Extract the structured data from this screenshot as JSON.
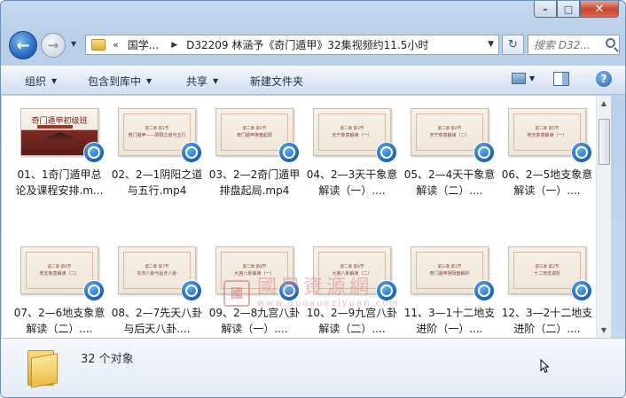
{
  "window": {
    "caption": {
      "minimize": "–",
      "maximize": "□",
      "close": "✕"
    }
  },
  "nav": {
    "back": "←",
    "forward": "→",
    "history_arrow": "▼",
    "address": {
      "chevron": "«",
      "crumbs": [
        "国学...",
        "D32209 林涵予《奇门遁甲》32集视频约11.5小时"
      ],
      "separator": "▶",
      "dropdown": "▼"
    },
    "refresh": "↻",
    "search_placeholder": "搜索 D32..."
  },
  "toolbar": {
    "organize": "组织",
    "include_library": "包含到库中",
    "share": "共享",
    "new_folder": "新建文件夹",
    "dropdown_arrow": "▼"
  },
  "files": [
    {
      "name": "01、1奇门遁甲总论及课程安排.m...",
      "thumb_title": "奇门遁甲初级班",
      "thumb_sub": "",
      "cover": true
    },
    {
      "name": "02、2—1阴阳之道与五行.mp4",
      "thumb_title": "第二章 第1节",
      "thumb_sub": "奇门遁甲——阴阳之道与五行"
    },
    {
      "name": "03、2—2奇门遁甲排盘起局.mp4",
      "thumb_title": "第二章 第2节",
      "thumb_sub": "奇门遁甲排盘起局"
    },
    {
      "name": "04、2—3天干象意解读（一）....",
      "thumb_title": "第二章 第3节",
      "thumb_sub": "天干象意解读（一）"
    },
    {
      "name": "05、2—4天干象意解读（二）....",
      "thumb_title": "第二章 第4节",
      "thumb_sub": "天干象意解读（二）"
    },
    {
      "name": "06、2—5地支象意解读（一）....",
      "thumb_title": "第二章 第5节",
      "thumb_sub": "地支象意解读（一）"
    },
    {
      "name": "07、2—6地支象意解读（二）....",
      "thumb_title": "第二章 第6节",
      "thumb_sub": "地支象意解读（二）"
    },
    {
      "name": "08、2—7先天八卦与后天八卦....",
      "thumb_title": "第二章 第7节",
      "thumb_sub": "先天八卦与后天八卦"
    },
    {
      "name": "09、2—8九宫八卦解读（一）....",
      "thumb_title": "第二章 第8节",
      "thumb_sub": "九宫八卦解读（一）"
    },
    {
      "name": "10、2—9九宫八卦解读（二）....",
      "thumb_title": "第二章 第9节",
      "thumb_sub": "九宫八卦解读（二）"
    },
    {
      "name": "11、3—1十二地支进阶（一）....",
      "thumb_title": "第三章 第1节",
      "thumb_sub": "奇门遁甲阴阳盘解析"
    },
    {
      "name": "12、3—2十二地支进阶（二）....",
      "thumb_title": "第三章 第2节",
      "thumb_sub": "十二地支进阶"
    }
  ],
  "watermark": {
    "seal": "國",
    "cn": "國學資源網",
    "url": "www.guoxueziyuan.com"
  },
  "status": {
    "count": "32 个对象"
  },
  "scrollbar": {
    "up": "▲",
    "down": "▼"
  },
  "colors": {
    "accent": "#2a6cc0",
    "media_icon": "#1e66bb",
    "folder": "#e0a92f"
  }
}
